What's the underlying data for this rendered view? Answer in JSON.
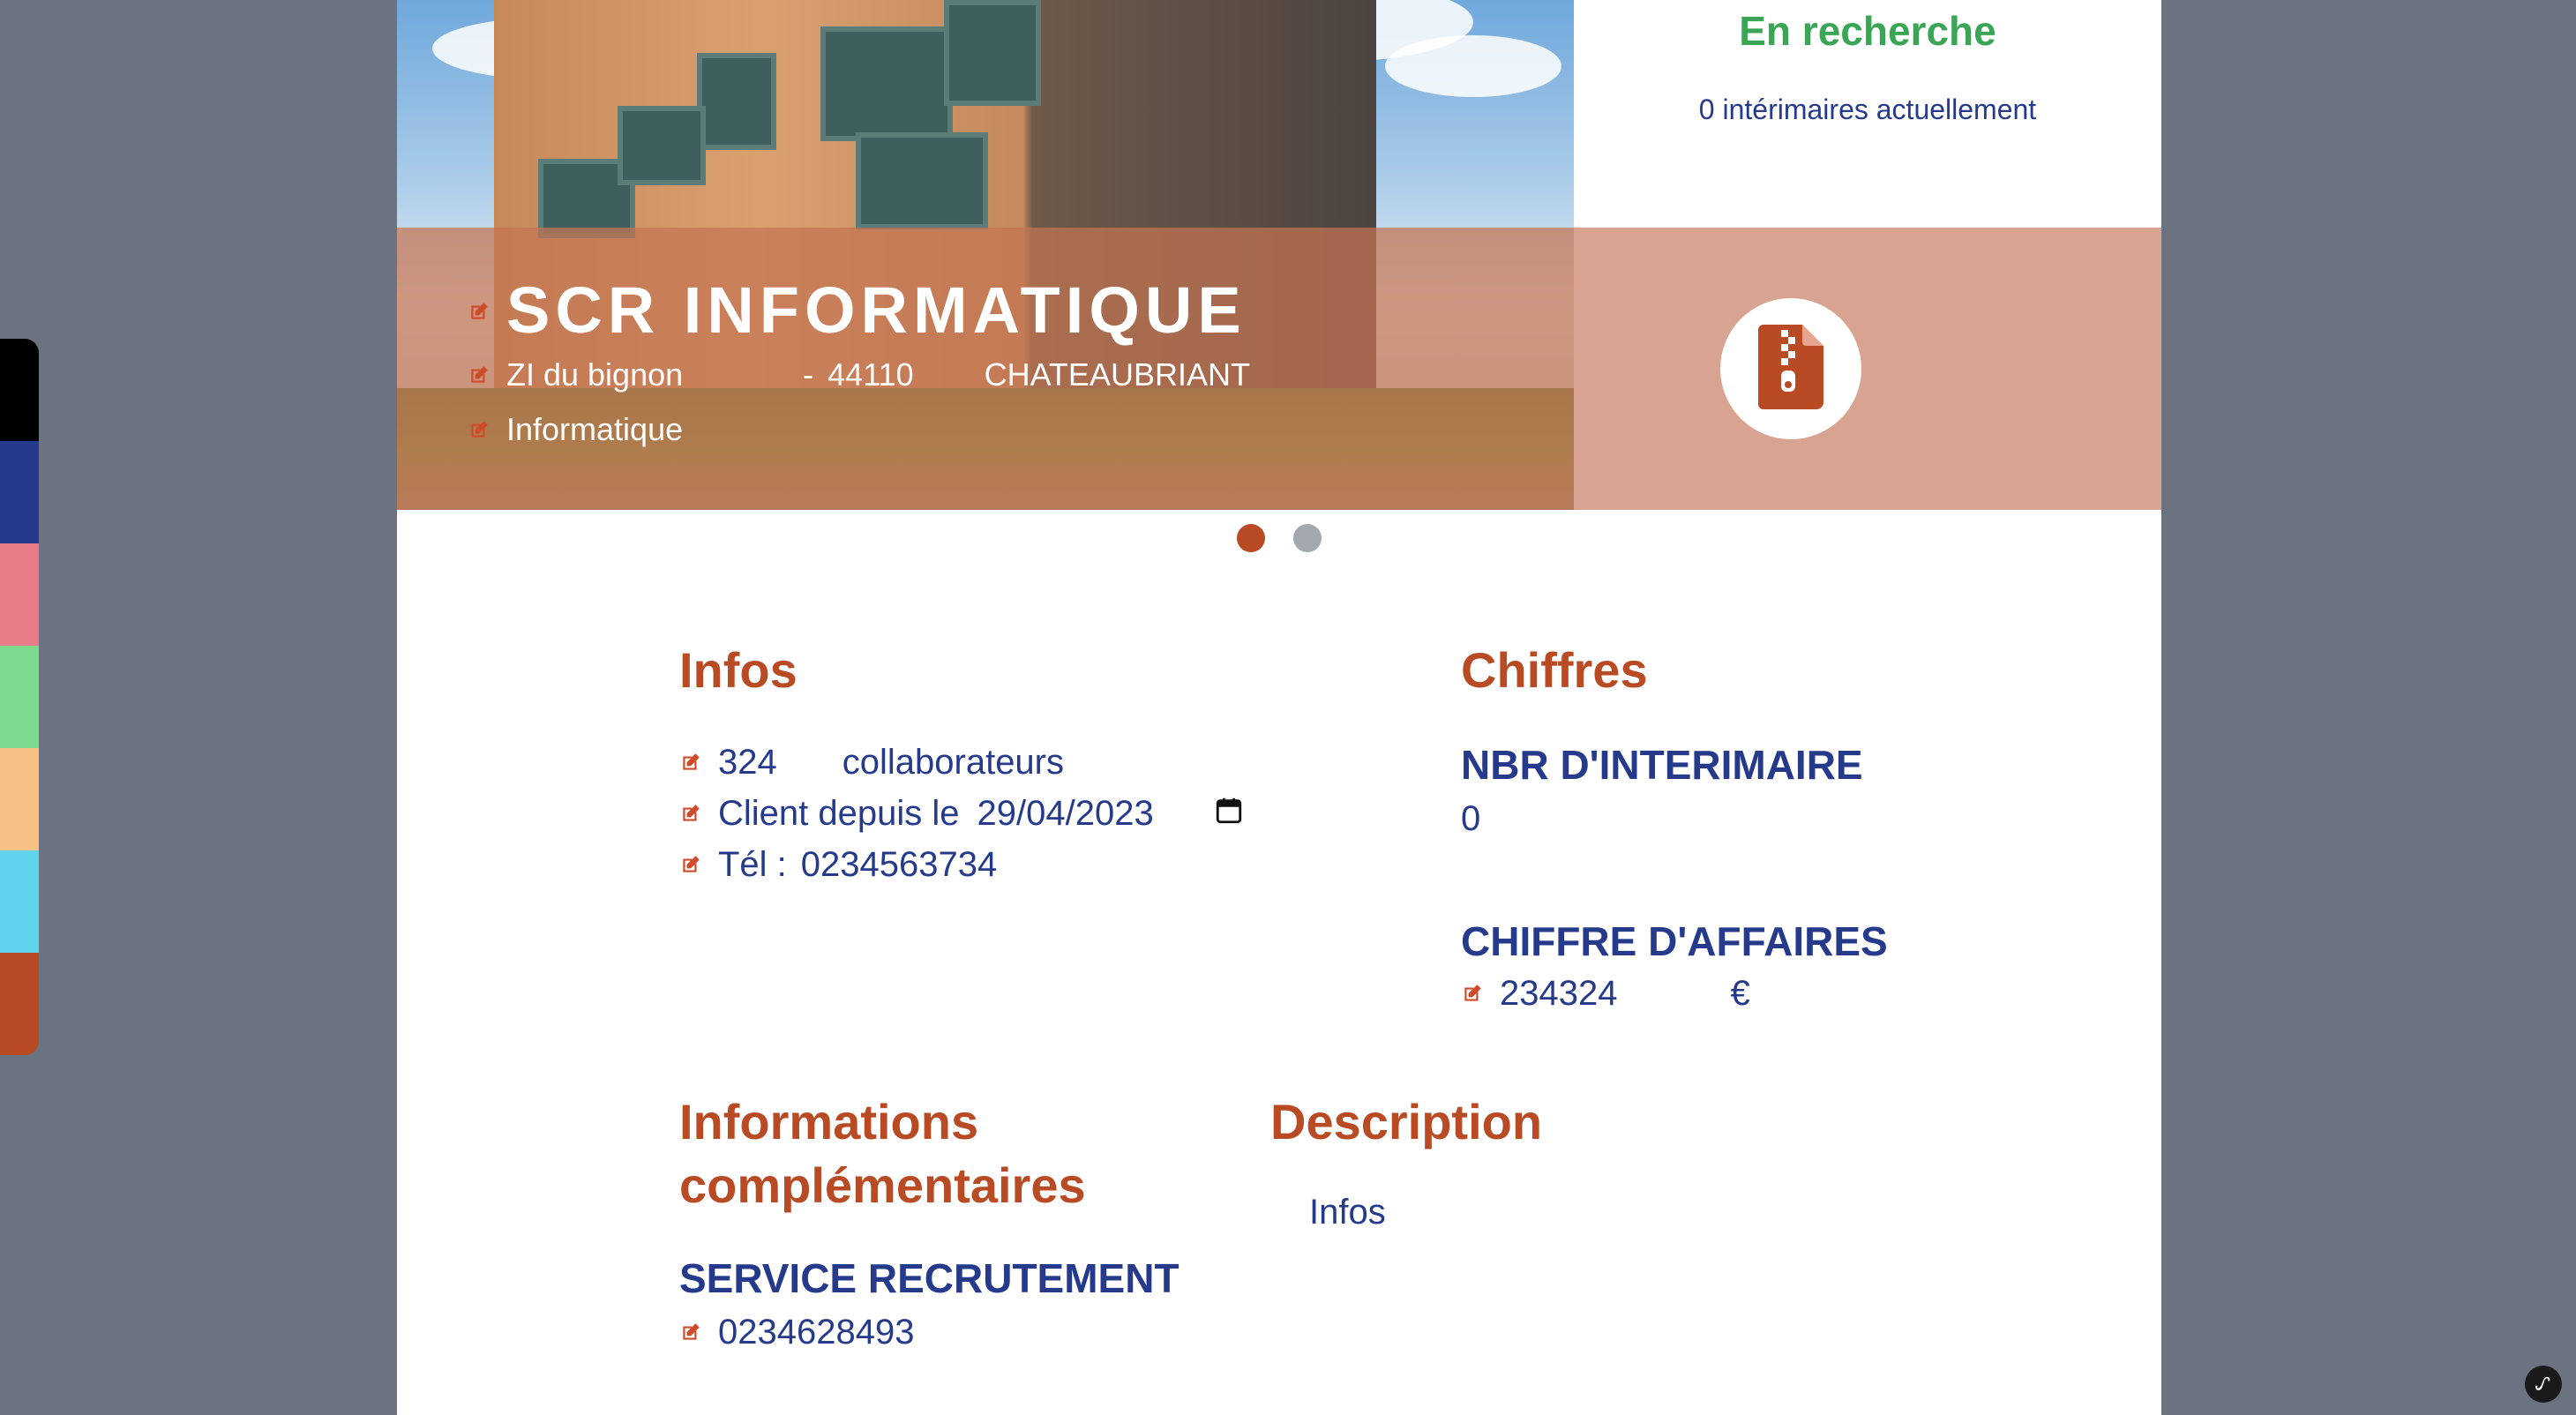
{
  "status": {
    "title": "En recherche",
    "subtitle": "0 intérimaires actuellement"
  },
  "company": {
    "name": "SCR INFORMATIQUE",
    "address": "ZI du bignon",
    "separator": "-",
    "postal_code": "44110",
    "city": "CHATEAUBRIANT",
    "sector": "Informatique"
  },
  "carousel": {
    "active_index": 0,
    "count": 2
  },
  "infos": {
    "heading": "Infos",
    "employees": "324",
    "employees_label": "collaborateurs",
    "client_since_label": "Client depuis le",
    "client_since_date": "29/04/2023",
    "phone_label": "Tél :",
    "phone": "0234563734"
  },
  "chiffres": {
    "heading": "Chiffres",
    "interim_label": "NBR D'INTERIMAIRE",
    "interim_value": "0",
    "revenue_label": "CHIFFRE D'AFFAIRES",
    "revenue_value": "234324",
    "currency": "€"
  },
  "complementary": {
    "heading_line1": "Informations",
    "heading_line2": "complémentaires",
    "service_label": "SERVICE RECRUTEMENT",
    "service_phone": "0234628493"
  },
  "description": {
    "heading": "Description",
    "text": "Infos"
  },
  "colors": {
    "accent": "#b84a24",
    "navy": "#263a8c",
    "green": "#3aa655",
    "strip": [
      "#000000",
      "#253a8a",
      "#e97c88",
      "#7dd98b",
      "#f5c184",
      "#5fd3ec",
      "#b84a24"
    ]
  },
  "icons": {
    "edit": "edit-icon",
    "calendar": "calendar-icon",
    "document": "file-zip-icon",
    "symfony": "symfony-icon"
  }
}
